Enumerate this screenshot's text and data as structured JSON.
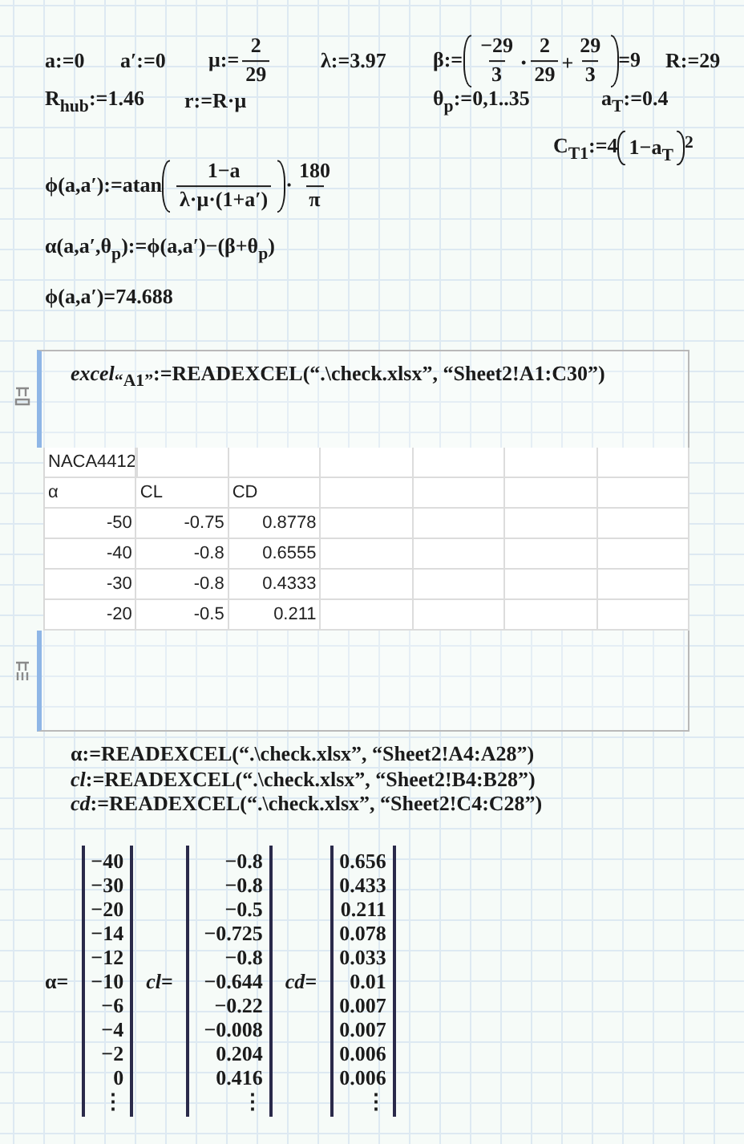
{
  "expressions": [
    {
      "parts": [
        {
          "kind": "text",
          "text": "a:=0"
        }
      ]
    },
    {
      "parts": [
        {
          "kind": "text",
          "text": "a′:=0"
        }
      ]
    },
    {
      "parts": [
        {
          "kind": "text",
          "text": "μ:="
        },
        {
          "kind": "frac",
          "num": "2",
          "den": "29"
        }
      ]
    },
    {
      "parts": [
        {
          "kind": "text",
          "text": "λ:=3.97"
        }
      ]
    },
    {
      "parts": [
        {
          "kind": "text",
          "text": "β:="
        },
        {
          "kind": "group",
          "parts": [
            {
              "kind": "frac",
              "num": "−29",
              "den": "3"
            },
            {
              "kind": "text",
              "text": "⋅"
            },
            {
              "kind": "frac",
              "num": "2",
              "den": "29"
            },
            {
              "kind": "text",
              "text": "+"
            },
            {
              "kind": "frac",
              "num": "29",
              "den": "3"
            }
          ]
        },
        {
          "kind": "text",
          "text": "=9"
        }
      ]
    },
    {
      "parts": [
        {
          "kind": "text",
          "text": "R:=29"
        }
      ]
    },
    {
      "parts": [
        {
          "kind": "text",
          "text": "R$_{hub}$:=1.46"
        }
      ]
    },
    {
      "parts": [
        {
          "kind": "text",
          "text": "r:=R·μ"
        }
      ]
    },
    {
      "parts": [
        {
          "kind": "text",
          "text": "θ$_{p}$:=0,1..35"
        }
      ]
    },
    {
      "parts": [
        {
          "kind": "text",
          "text": "a$_{T}$:=0.4"
        }
      ]
    },
    {
      "parts": [
        {
          "kind": "text",
          "text": "C$_{T1}$:=4 "
        },
        {
          "kind": "group",
          "parts": [
            {
              "kind": "text",
              "text": "1−a$_{T}$"
            }
          ]
        },
        {
          "kind": "text",
          "text": "$^{2}$"
        }
      ]
    },
    {
      "parts": [
        {
          "kind": "text",
          "text": "ϕ(a,a′):=atan"
        },
        {
          "kind": "group",
          "parts": [
            {
              "kind": "frac",
              "num": "1−a",
              "den": "λ·μ·(1+a′)"
            }
          ]
        },
        {
          "kind": "text",
          "text": "·"
        },
        {
          "kind": "frac",
          "num": "180",
          "den": "π"
        }
      ]
    },
    {
      "parts": [
        {
          "kind": "text",
          "text": "α(a,a′,θ$_{p}$):=ϕ(a,a′)−(β+θ$_{p}$)"
        }
      ]
    },
    {
      "parts": [
        {
          "kind": "text",
          "text": "ϕ(a,a′)=74.688"
        }
      ]
    }
  ],
  "excel_component": {
    "formula": "*excel*$_{“A1”}$:=READEXCEL(“.\\check.xlsx”, “Sheet2!A1:C30”)",
    "rows": [
      {
        "kind": "title",
        "cells": [
          "NACA4412"
        ]
      },
      {
        "kind": "heading",
        "cells": [
          "α",
          "CL",
          "CD"
        ]
      },
      {
        "kind": "data",
        "cells": [
          "-50",
          "-0.75",
          "0.8778"
        ]
      },
      {
        "kind": "data",
        "cells": [
          "-40",
          "-0.8",
          "0.6555"
        ]
      },
      {
        "kind": "data",
        "cells": [
          "-30",
          "-0.8",
          "0.4333"
        ]
      },
      {
        "kind": "data",
        "cells": [
          "-20",
          "-0.5",
          "0.211"
        ]
      }
    ]
  },
  "definitions": [
    "α:=READEXCEL(“.\\check.xlsx”, “Sheet2!A4:A28”)",
    "*cl*:=READEXCEL(“.\\check.xlsx”, “Sheet2!B4:B28”)",
    "*cd*:=READEXCEL(“.\\check.xlsx”, “Sheet2!C4:C28”)"
  ],
  "matrices": [
    {
      "label": "α=",
      "values": [
        "−40",
        "−30",
        "−20",
        "−14",
        "−12",
        "−10",
        "−6",
        "−4",
        "−2",
        "0",
        "⋮"
      ]
    },
    {
      "label": "*cl*=",
      "values": [
        "−0.8",
        "−0.8",
        "−0.5",
        "−0.725",
        "−0.8",
        "−0.644",
        "−0.22",
        "−0.008",
        "0.204",
        "0.416",
        "⋮"
      ]
    },
    {
      "label": "*cd*=",
      "values": [
        "0.656",
        "0.433",
        "0.211",
        "0.078",
        "0.033",
        "0.01",
        "0.007",
        "0.007",
        "0.006",
        "0.006",
        "⋮"
      ]
    }
  ]
}
